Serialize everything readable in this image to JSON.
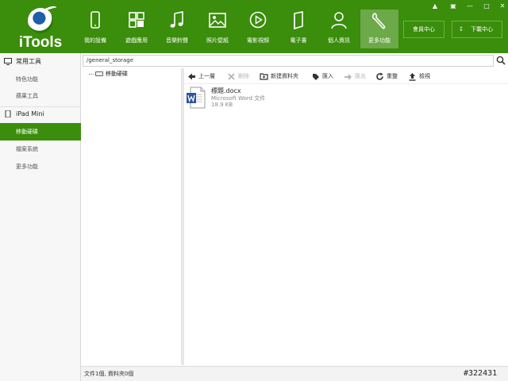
{
  "app": {
    "name": "iTools"
  },
  "nav": [
    {
      "label": "我的設備",
      "icon": "phone-icon"
    },
    {
      "label": "遊戲應用",
      "icon": "apps-icon"
    },
    {
      "label": "音樂鈴聲",
      "icon": "music-icon"
    },
    {
      "label": "照片壁紙",
      "icon": "photo-icon"
    },
    {
      "label": "電影視頻",
      "icon": "video-icon"
    },
    {
      "label": "電子書",
      "icon": "book-icon"
    },
    {
      "label": "個人資訊",
      "icon": "person-icon"
    },
    {
      "label": "更多功能",
      "icon": "wrench-icon"
    }
  ],
  "header_buttons": {
    "member": "會員中心",
    "download": "下載中心"
  },
  "sidebar": {
    "sections": [
      {
        "title": "常用工具",
        "icon": "monitor-icon",
        "items": [
          "特色功能",
          "蘋果工具"
        ]
      },
      {
        "title": "iPad Mini",
        "icon": "tablet-icon",
        "items": [
          "移動硬碟",
          "檔案系統",
          "更多功能"
        ]
      }
    ],
    "active_item": "移動硬碟"
  },
  "path": {
    "value": "/general_storage"
  },
  "tree": {
    "root": "移動硬碟"
  },
  "toolbar": {
    "back": "上一層",
    "delete": "刪除",
    "new_folder": "新建資料夾",
    "import": "匯入",
    "export": "匯出",
    "refresh": "重整",
    "view": "檢視"
  },
  "files": [
    {
      "name": "標題.docx",
      "type": "Microsoft Word 文件",
      "size": "18.9 KB"
    }
  ],
  "status": {
    "text": "文件1個, 資料夾0個"
  },
  "watermark": "#322431",
  "colors": {
    "accent": "#3b8d0c",
    "word_blue": "#2b579a"
  }
}
